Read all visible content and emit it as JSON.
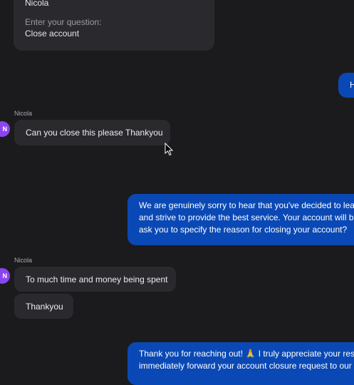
{
  "form_card": {
    "name": "Nicola",
    "question_label": "Enter your question:",
    "question_value": "Close account"
  },
  "messages": [
    {
      "sender": "Nicola",
      "avatar_initial": "N",
      "text": "Can you close this please Thankyou"
    },
    {
      "sender": "Nicola",
      "avatar_initial": "N",
      "text": "To much time and money being spent",
      "text2": "Thankyou"
    }
  ],
  "agent_messages": [
    {
      "text": "H"
    },
    {
      "lines": [
        "We are genuinely sorry to hear that you've decided to leav",
        "and strive to provide the best service. Your account will be",
        "ask you to specify the reason for closing your account?"
      ]
    },
    {
      "lines": [
        "Thank you for reaching out! 🙏 I truly appreciate your resp",
        "immediately forward your account closure request to our"
      ]
    }
  ],
  "colors": {
    "background": "#1b1b1d",
    "bubble_incoming": "#2a2a2e",
    "bubble_outgoing": "#0a49b5",
    "avatar": "#8b45f0"
  }
}
